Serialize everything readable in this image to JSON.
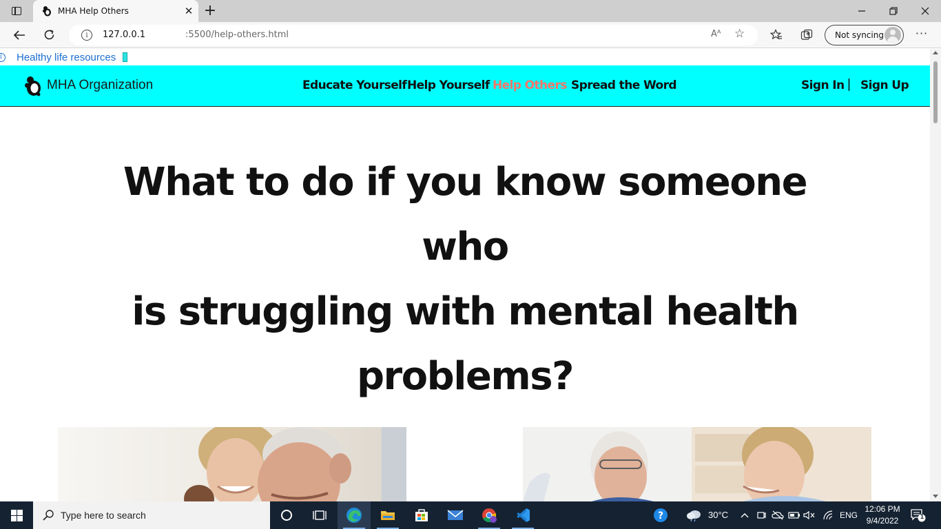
{
  "browser": {
    "tab_title": "MHA Help Others",
    "url_host": "127.0.0.1",
    "url_path": ":5500/help-others.html",
    "readaloud": "Aᴬ",
    "sync_label": "Not syncing"
  },
  "page": {
    "top_link": "Healthy life resources",
    "brand_name": "MHA Organization",
    "nav": [
      {
        "label": "Educate Yourself"
      },
      {
        "label": "Help Yourself"
      },
      {
        "label": "Help Others"
      },
      {
        "label": "Spread the Word"
      }
    ],
    "active_nav": "Help Others",
    "auth": {
      "sign_in": "Sign In",
      "separator": "|",
      "sign_up": "Sign Up"
    },
    "hero_lines": [
      "What to do if you know someone who",
      "is struggling with mental health",
      "problems?"
    ]
  },
  "taskbar": {
    "search_placeholder": "Type here to search",
    "weather": "30°C",
    "language": "ENG",
    "time": "12:06 PM",
    "date": "9/4/2022",
    "notification_count": "1"
  },
  "colors": {
    "nav_background": "#00ffff",
    "nav_active": "#f2776a",
    "link_blue": "#1c6fd1",
    "taskbar": "#152232"
  }
}
